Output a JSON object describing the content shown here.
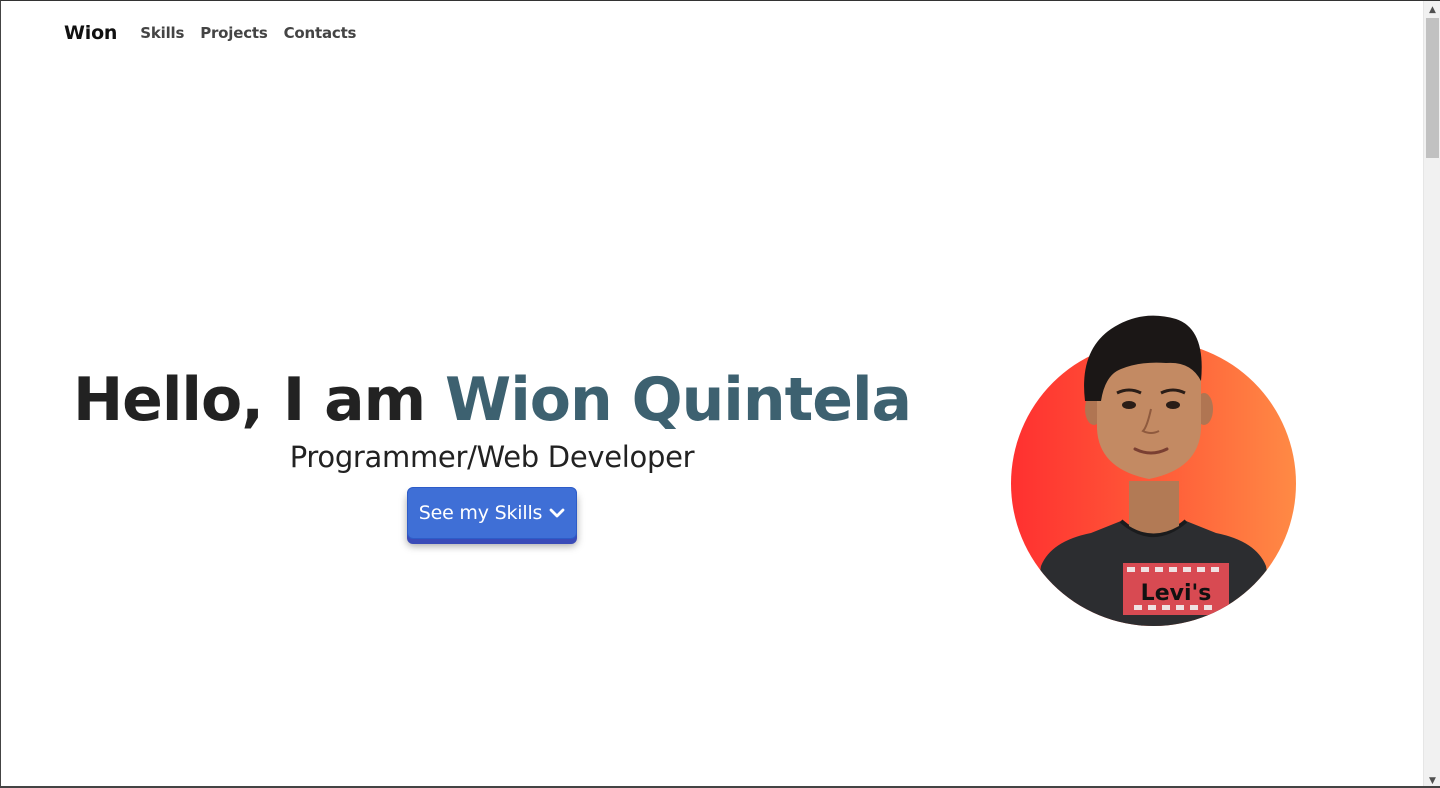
{
  "nav": {
    "brand": "Wion",
    "links": [
      "Skills",
      "Projects",
      "Contacts"
    ]
  },
  "hero": {
    "greeting": "Hello, I am ",
    "name": "Wion Quintela",
    "subtitle": "Programmer/Web Developer",
    "cta_label": "See my Skills"
  },
  "profile_photo": {
    "shirt_text": "Levi's"
  },
  "colors": {
    "accent_name": "#3d6170",
    "button": "#3f6fd6",
    "gradient_start": "#ff3030",
    "gradient_end": "#ff8a45"
  },
  "icons": {
    "cta_icon": "chevron-down-icon"
  }
}
